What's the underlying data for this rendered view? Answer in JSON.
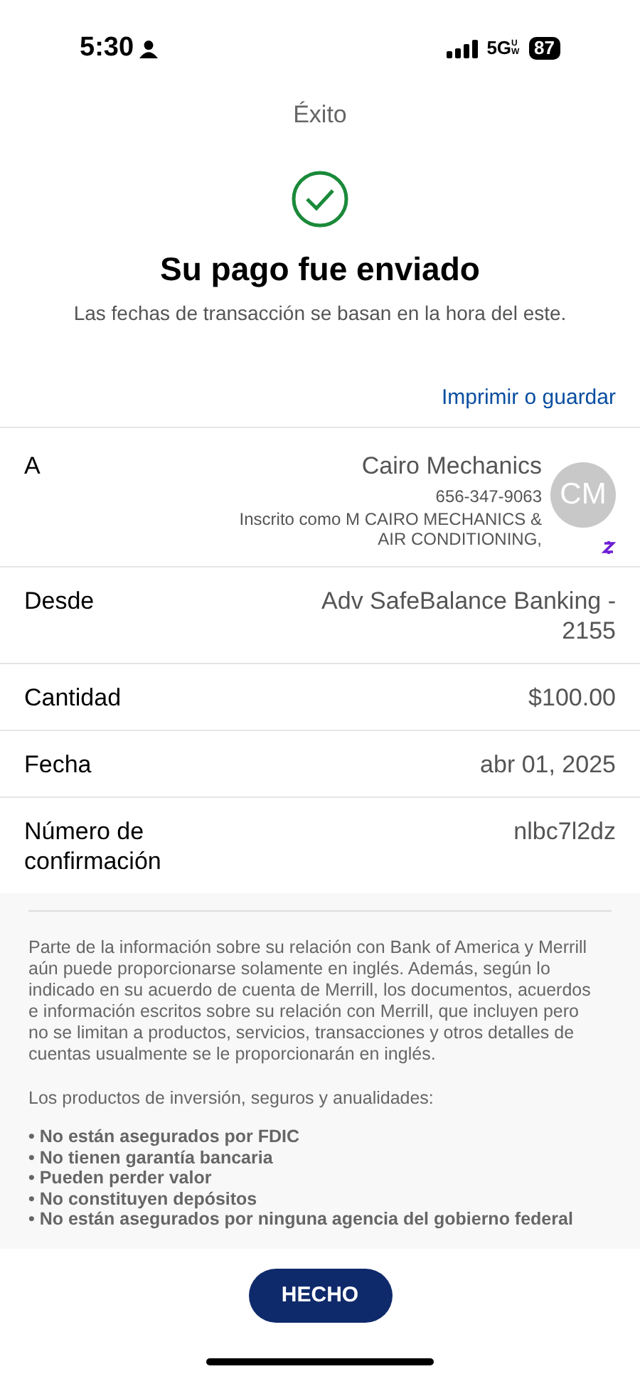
{
  "status_bar": {
    "time": "5:30",
    "network": "5G",
    "network_sub": "UW",
    "battery": "87"
  },
  "header": {
    "title": "Éxito"
  },
  "confirmation": {
    "heading": "Su pago fue enviado",
    "subtitle": "Las fechas de transacción se basan en la hora del este."
  },
  "print_link": "Imprimir o guardar",
  "recipient": {
    "label": "A",
    "name": "Cairo Mechanics",
    "phone": "656-347-9063",
    "enrolled": "Inscrito como M CAIRO MECHANICS & AIR CONDITIONING,",
    "initials": "CM"
  },
  "details": [
    {
      "label": "Desde",
      "value": "Adv SafeBalance Banking - 2155"
    },
    {
      "label": "Cantidad",
      "value": "$100.00"
    },
    {
      "label": "Fecha",
      "value": "abr 01, 2025"
    },
    {
      "label": "Número de confirmación",
      "value": "nlbc7l2dz"
    }
  ],
  "disclosure": {
    "paragraph": "Parte de la información sobre su relación con Bank of America y Merrill aún puede proporcionarse solamente en inglés. Además, según lo indicado en su acuerdo de cuenta de Merrill, los documentos, acuerdos e información escritos sobre su relación con Merrill, que incluyen pero no se limitan a productos, servicios, transacciones y otros detalles de cuentas usualmente se le proporcionarán en inglés.",
    "intro": "Los productos de inversión, seguros y anualidades:",
    "bullets": [
      "• No están asegurados por FDIC",
      "• No tienen garantía bancaria",
      "• Pueden perder valor",
      "• No constituyen depósitos",
      "• No están asegurados por ninguna agencia del gobierno federal"
    ]
  },
  "done_button": "HECHO"
}
